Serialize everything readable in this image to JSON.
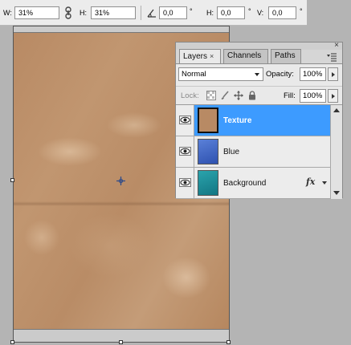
{
  "options_bar": {
    "width_label": "W:",
    "width_value": "31%",
    "height_label": "H:",
    "height_value": "31%",
    "rotate_value": "0,0",
    "rotate_unit": "°",
    "hskew_label": "H:",
    "hskew_value": "0,0",
    "hskew_unit": "°",
    "vskew_label": "V:",
    "vskew_value": "0,0",
    "vskew_unit": "°"
  },
  "layers_panel": {
    "close_glyph": "×",
    "tabs": [
      {
        "label": "Layers",
        "close": "×",
        "active": true
      },
      {
        "label": "Channels",
        "active": false
      },
      {
        "label": "Paths",
        "active": false
      }
    ],
    "blend_mode": "Normal",
    "opacity_label": "Opacity:",
    "opacity_value": "100%",
    "lock_label": "Lock:",
    "fill_label": "Fill:",
    "fill_value": "100%",
    "layers": [
      {
        "name": "Texture",
        "selected": true,
        "thumb_color": "#b88a64"
      },
      {
        "name": "Blue",
        "selected": false,
        "thumb_color": "#3d63c4"
      },
      {
        "name": "Background",
        "selected": false,
        "thumb_color": "#1e8e9a",
        "fx": "fx"
      }
    ]
  },
  "colors": {
    "selection_blue": "#3d9bff",
    "canvas_gray": "#b4b4b4"
  }
}
